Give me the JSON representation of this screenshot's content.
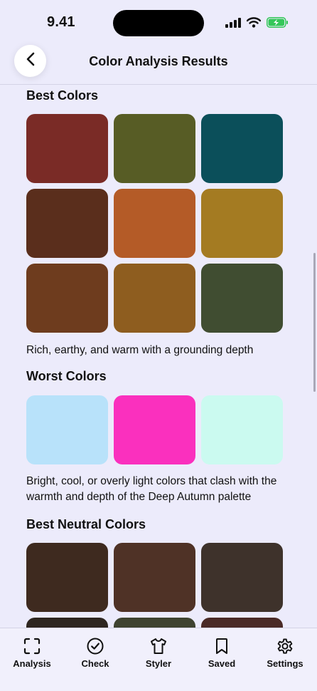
{
  "status_bar": {
    "time": "9.41"
  },
  "header": {
    "title": "Color Analysis Results"
  },
  "sections": {
    "best": {
      "title": "Best Colors",
      "colors": [
        "#7A2B26",
        "#575C25",
        "#0B4F5A",
        "#5A2E1C",
        "#B45B27",
        "#A47B22",
        "#6E3C1E",
        "#8E5D1F",
        "#404D31"
      ],
      "description": "Rich, earthy, and warm with a grounding depth"
    },
    "worst": {
      "title": "Worst Colors",
      "colors": [
        "#B8E2FA",
        "#FA30BE",
        "#CBFAF0"
      ],
      "description": "Bright, cool, or overly light colors that clash with the warmth and depth of the Deep Autumn palette"
    },
    "neutral": {
      "title": "Best Neutral Colors",
      "colors": [
        "#3E2A1F",
        "#4F3226",
        "#3E322B",
        "#2E2620",
        "#3F4330",
        "#4A2A26"
      ]
    }
  },
  "tabs": [
    {
      "label": "Analysis",
      "icon": "scan-icon"
    },
    {
      "label": "Check",
      "icon": "check-circle-icon"
    },
    {
      "label": "Styler",
      "icon": "shirt-icon"
    },
    {
      "label": "Saved",
      "icon": "bookmark-icon"
    },
    {
      "label": "Settings",
      "icon": "gear-icon"
    }
  ],
  "colors": {
    "background": "#ECEBFB",
    "tab_bar": "#F1F0FC",
    "battery_fill": "#34C759"
  }
}
